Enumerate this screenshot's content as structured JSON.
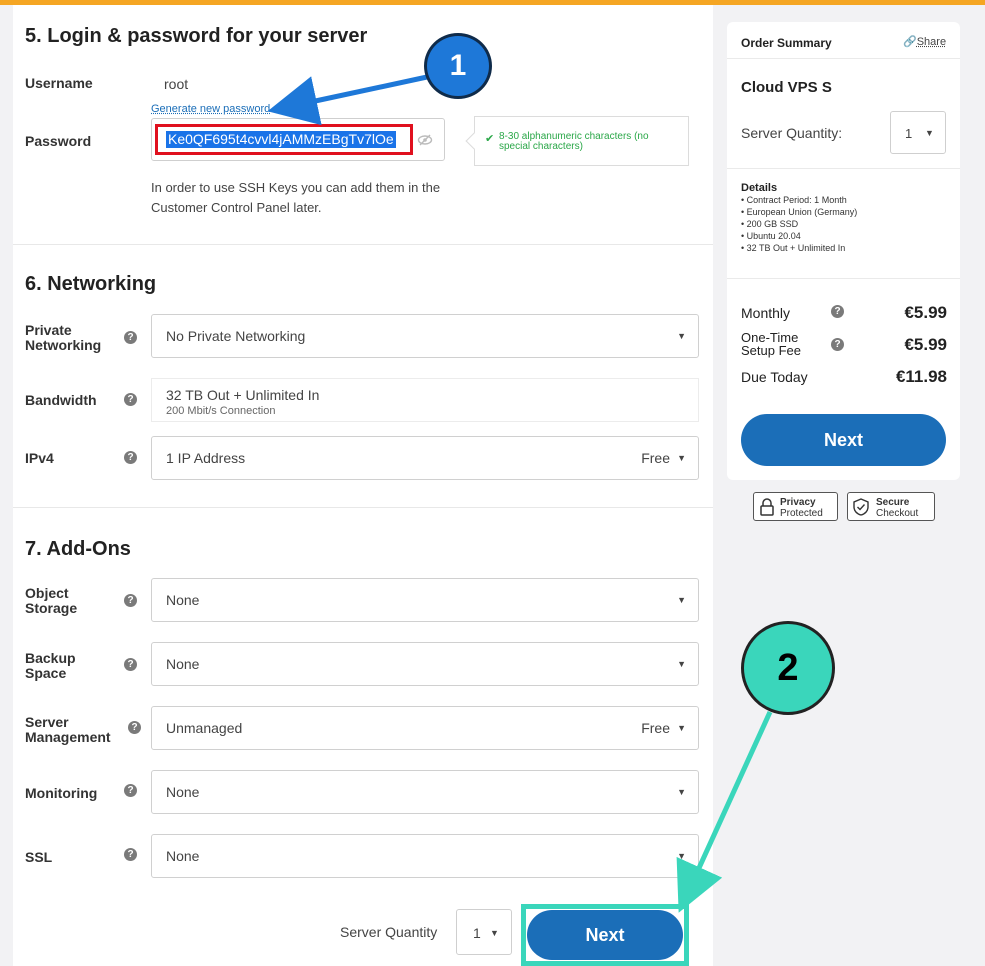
{
  "login": {
    "title": "5. Login & password for your server",
    "username_label": "Username",
    "username_value": "root",
    "generate_link": "Generate new password",
    "password_label": "Password",
    "password_value": "Ke0QF695t4cvvl4jAMMzEBgTv7lOe",
    "hint_check": "✔",
    "hint_text": "8-30 alphanumeric characters (no special characters)",
    "ssh_note": "In order to use SSH Keys you can add them in the Customer Control Panel later."
  },
  "networking": {
    "title": "6. Networking",
    "private_label": "Private Networking",
    "private_value": "No Private Networking",
    "bandwidth_label": "Bandwidth",
    "bandwidth_value": "32 TB Out + Unlimited In",
    "bandwidth_sub": "200 Mbit/s Connection",
    "ipv4_label": "IPv4",
    "ipv4_value": "1 IP Address",
    "ipv4_price": "Free"
  },
  "addons": {
    "title": "7. Add-Ons",
    "object_label": "Object Storage",
    "object_value": "None",
    "backup_label": "Backup Space",
    "backup_value": "None",
    "mgmt_label": "Server Management",
    "mgmt_value": "Unmanaged",
    "mgmt_price": "Free",
    "monitoring_label": "Monitoring",
    "monitoring_value": "None",
    "ssl_label": "SSL",
    "ssl_value": "None"
  },
  "footer": {
    "qty_label": "Server Quantity",
    "qty_value": "1",
    "next_label": "Next"
  },
  "summary": {
    "title": "Order Summary",
    "share": "Share",
    "product": "Cloud VPS S",
    "qty_label": "Server Quantity:",
    "qty_value": "1",
    "details_title": "Details",
    "details": [
      "Contract Period: 1 Month",
      "European Union (Germany)",
      "200 GB SSD",
      "Ubuntu 20.04",
      "32 TB Out + Unlimited In"
    ],
    "monthly_label": "Monthly",
    "monthly_price": "€5.99",
    "setup_label": "One-Time Setup Fee",
    "setup_price": "€5.99",
    "due_label": "Due Today",
    "due_price": "€11.98",
    "next_label": "Next"
  },
  "badges": {
    "privacy_1": "Privacy",
    "privacy_2": "Protected",
    "secure_1": "Secure",
    "secure_2": "Checkout"
  },
  "annotations": {
    "step1": "1",
    "step2": "2"
  },
  "colors": {
    "accent": "#1b6eb8",
    "top_bar": "#f5a623",
    "highlight_red": "#e0101e",
    "highlight_teal": "#3ad6bb"
  }
}
